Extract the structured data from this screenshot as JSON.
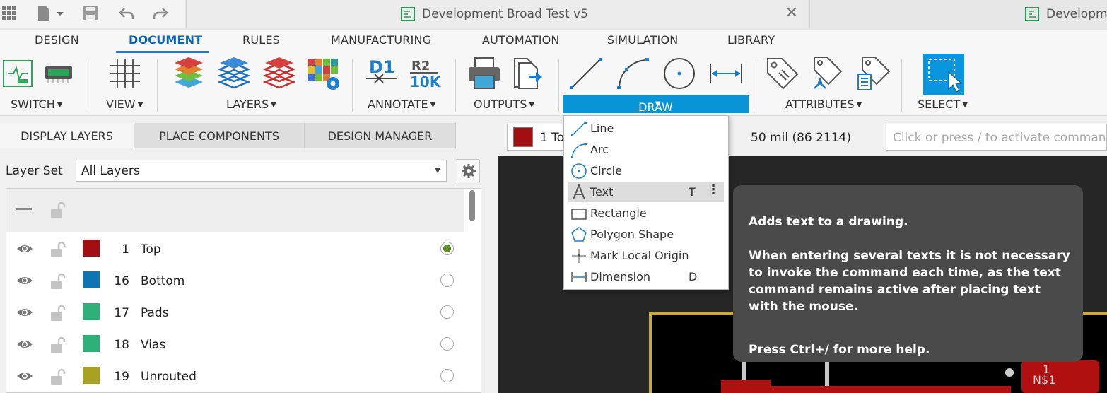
{
  "window": {
    "active_tab_title": "Development Broad Test v5",
    "other_tab_title": "Developme"
  },
  "ribbon": {
    "tabs": [
      "DESIGN",
      "DOCUMENT",
      "RULES",
      "MANUFACTURING",
      "AUTOMATION",
      "SIMULATION",
      "LIBRARY"
    ],
    "active_tab": "DOCUMENT",
    "groups": {
      "switch": "SWITCH",
      "view": "VIEW",
      "layers": "LAYERS",
      "annotate": "ANNOTATE",
      "outputs": "OUTPUTS",
      "draw": "DRAW",
      "attributes": "ATTRIBUTES",
      "select": "SELECT"
    },
    "annotate_icons": {
      "d1": "D1",
      "r2": "R2",
      "r2_value": "10K"
    }
  },
  "left_panel": {
    "tabs": [
      "DISPLAY LAYERS",
      "PLACE COMPONENTS",
      "DESIGN MANAGER"
    ],
    "active_tab": "DISPLAY LAYERS",
    "layer_set_label": "Layer Set",
    "layer_set_value": "All Layers",
    "layers": [
      {
        "number": "1",
        "name": "Top",
        "color": "#a30f10",
        "active": true
      },
      {
        "number": "16",
        "name": "Bottom",
        "color": "#0f74b4",
        "active": false
      },
      {
        "number": "17",
        "name": "Pads",
        "color": "#2fb07a",
        "active": false
      },
      {
        "number": "18",
        "name": "Vias",
        "color": "#2fb07a",
        "active": false
      },
      {
        "number": "19",
        "name": "Unrouted",
        "color": "#a8a21e",
        "active": false
      }
    ]
  },
  "status": {
    "current_layer": "1 To",
    "grid": "50 mil (86 2114)",
    "command_placeholder": "Click or press / to activate command li"
  },
  "draw_menu": {
    "items": [
      {
        "label": "Line",
        "shortcut": "",
        "icon": "line-icon"
      },
      {
        "label": "Arc",
        "shortcut": "",
        "icon": "arc-icon"
      },
      {
        "label": "Circle",
        "shortcut": "",
        "icon": "circle-icon"
      },
      {
        "label": "Text",
        "shortcut": "T",
        "icon": "text-icon",
        "highlighted": true
      },
      {
        "label": "Rectangle",
        "shortcut": "",
        "icon": "rectangle-icon"
      },
      {
        "label": "Polygon Shape",
        "shortcut": "",
        "icon": "polygon-icon"
      },
      {
        "label": "Mark Local Origin",
        "shortcut": "",
        "icon": "origin-icon"
      },
      {
        "label": "Dimension",
        "shortcut": "D",
        "icon": "dimension-icon"
      }
    ]
  },
  "tooltip": {
    "title": "Adds text to a drawing.",
    "body": "When entering several texts it is not necessary to invoke the command each time, as the text command remains active after placing text with the mouse.",
    "help": "Press Ctrl+/ for more help."
  },
  "canvas_labels": {
    "pad_number": "1",
    "net_name": "N$1"
  },
  "colors": {
    "accent": "#0a94d8",
    "active_tab_text": "#0a66b5",
    "canvas_bg": "#262626",
    "tooltip_bg": "#4a4a4a",
    "board_outline": "#c9a84a"
  }
}
